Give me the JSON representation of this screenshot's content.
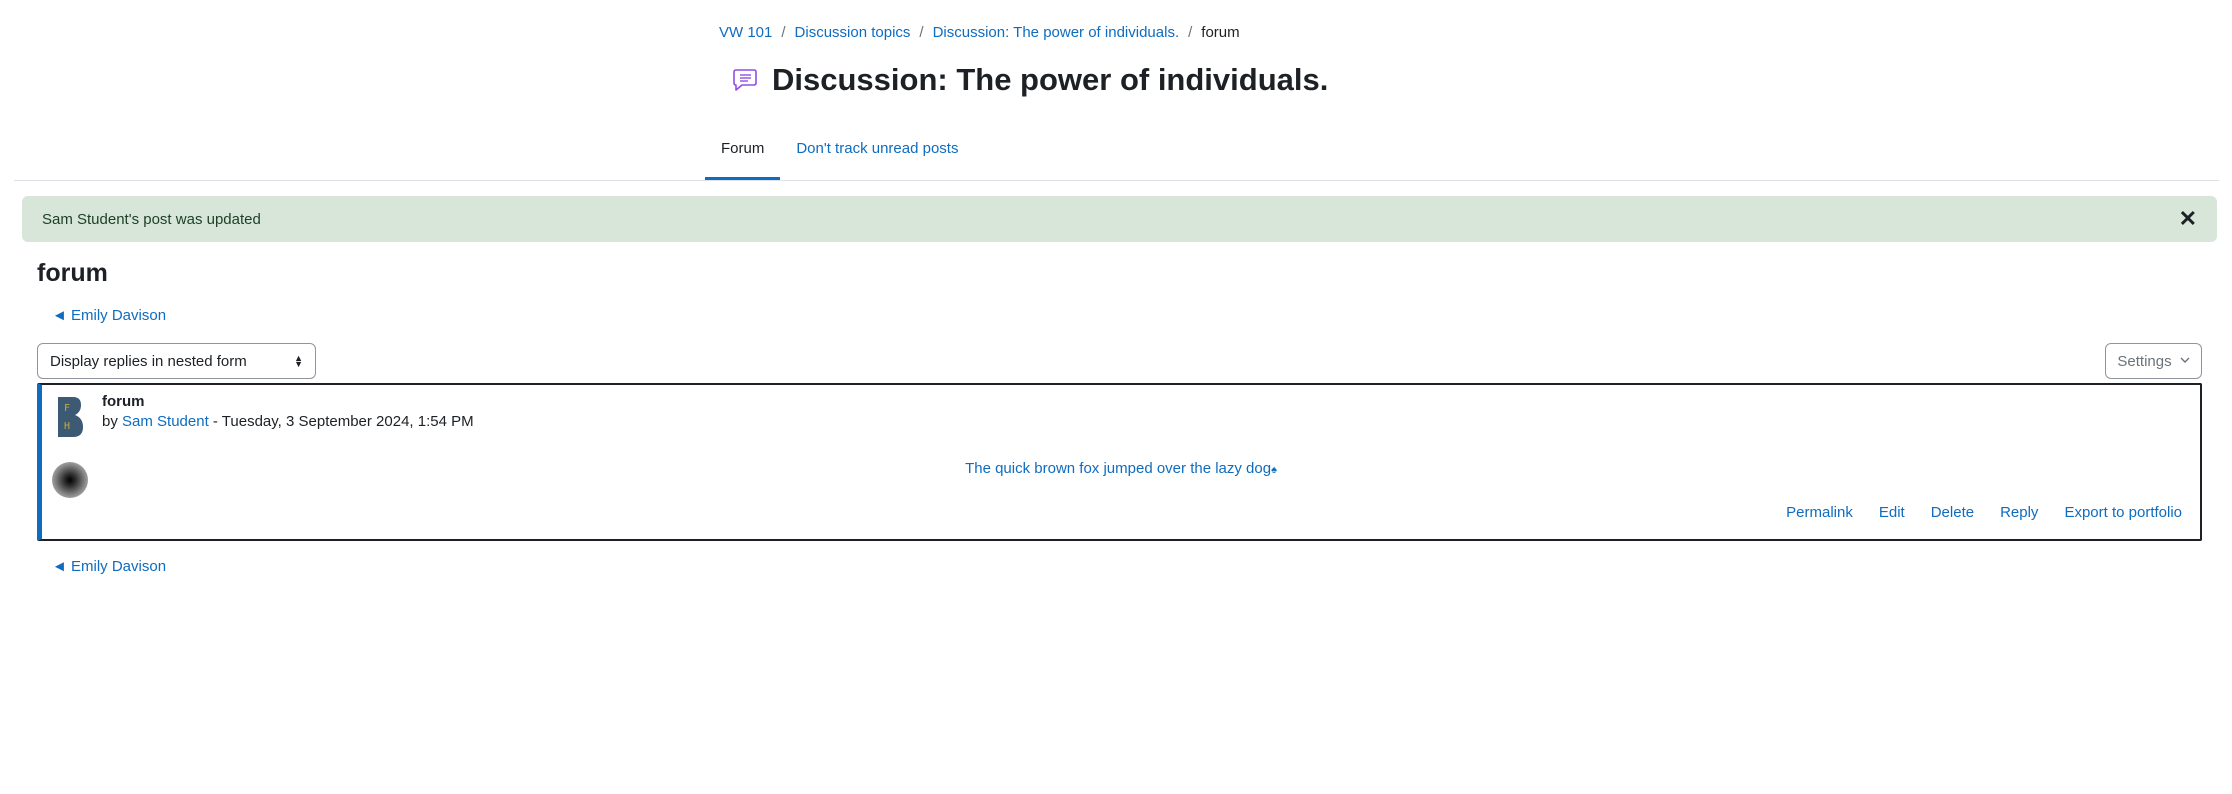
{
  "breadcrumb": {
    "items": [
      "VW 101",
      "Discussion topics",
      "Discussion: The power of individuals."
    ],
    "current": "forum",
    "separator": "/"
  },
  "page": {
    "title": "Discussion: The power of individuals."
  },
  "tabs": {
    "forum": "Forum",
    "track": "Don't track unread posts"
  },
  "alert": {
    "message": "Sam Student's post was updated",
    "close": "✕"
  },
  "forum_title": "forum",
  "nav": {
    "prev_top": "◄ Emily Davison",
    "prev_bottom": "◄ Emily Davison"
  },
  "display_select": {
    "value": "Display replies in nested form"
  },
  "settings": {
    "label": "Settings"
  },
  "post": {
    "subject": "forum",
    "by": "by",
    "author": "Sam Student",
    "date": " - Tuesday, 3 September 2024, 1:54 PM",
    "content": "The quick brown fox jumped over the lazy dog",
    "avatar_letters": [
      "F",
      "H"
    ],
    "actions": {
      "permalink": "Permalink",
      "edit": "Edit",
      "delete": "Delete",
      "reply": "Reply",
      "export": "Export to portfolio"
    }
  },
  "colors": {
    "link": "#0f6cbf",
    "alert_bg": "#d7e6d9",
    "forum_icon": "#8f4ee6",
    "avatar_bg": "#3c5a73",
    "avatar_text": "#c9a93a"
  }
}
